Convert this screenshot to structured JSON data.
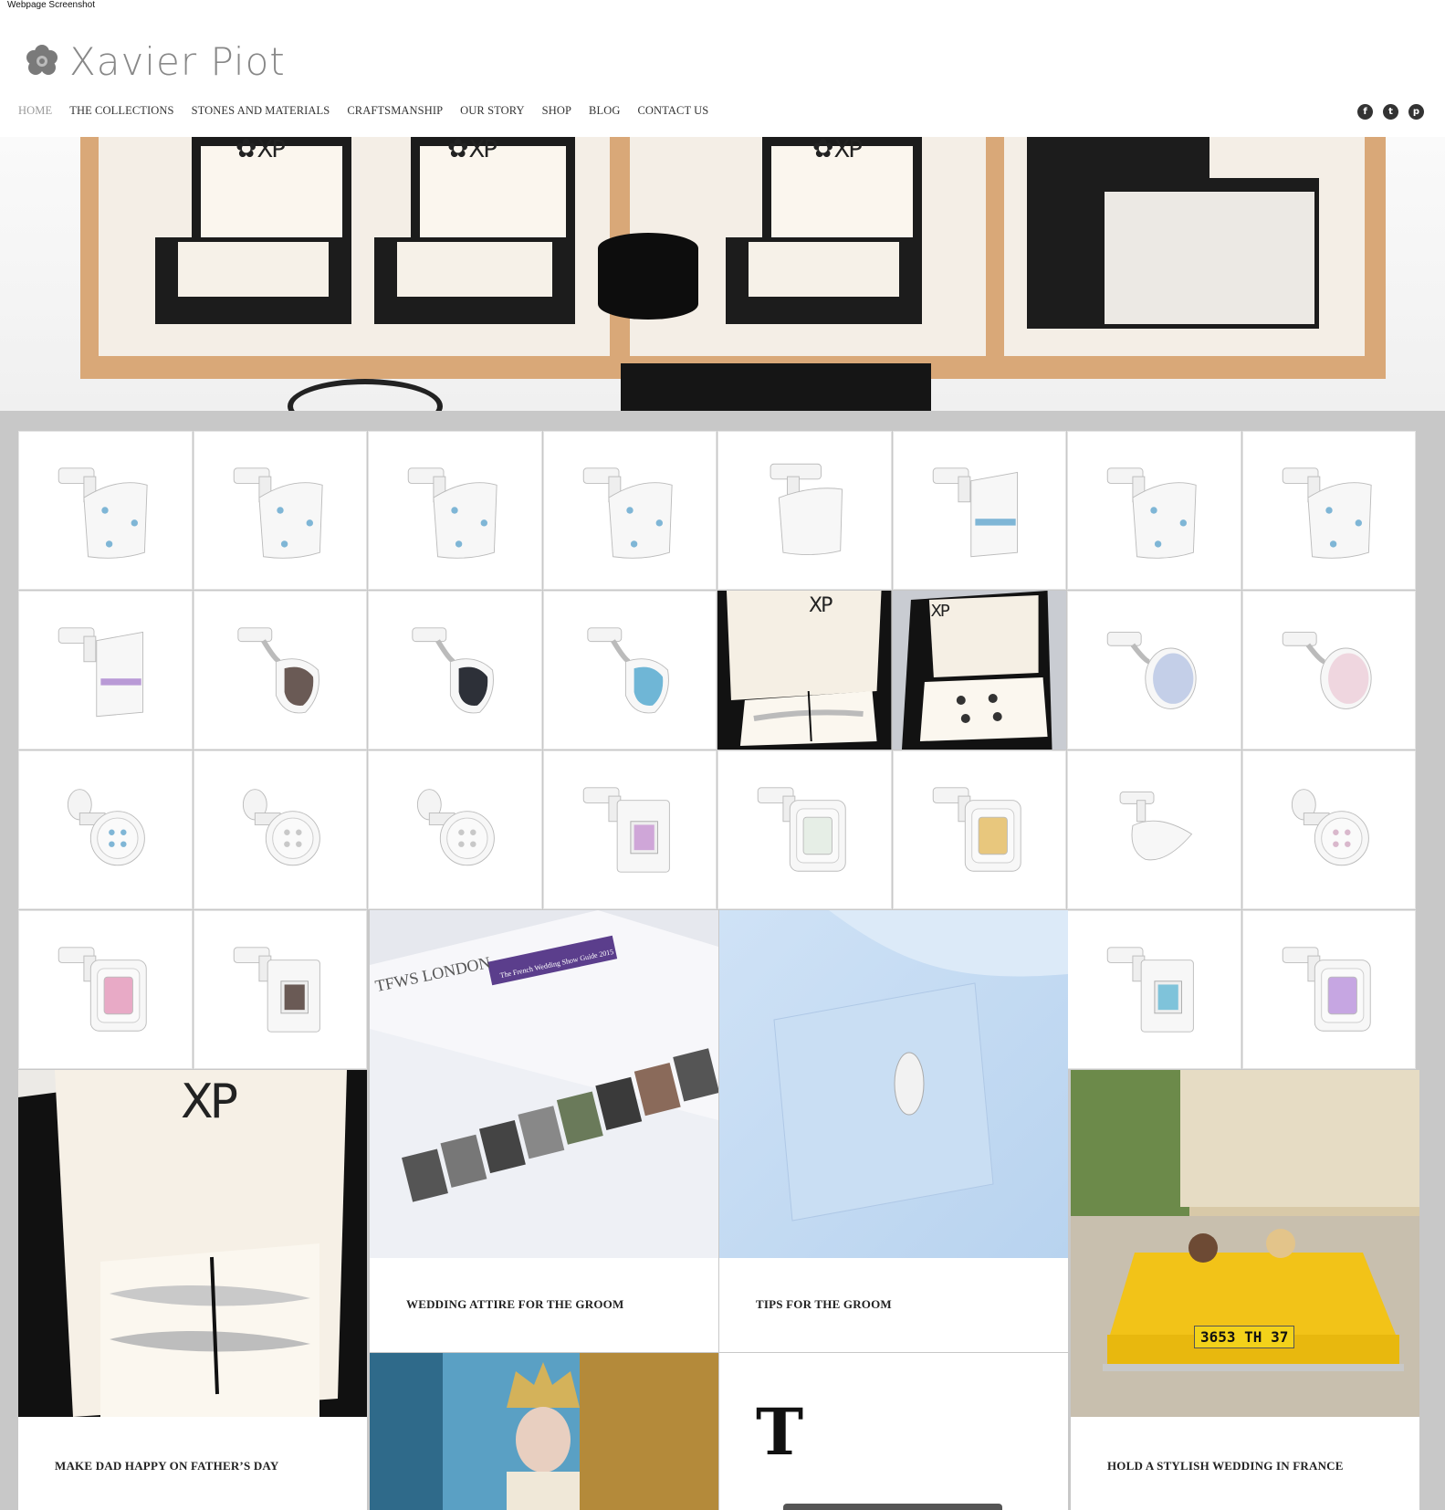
{
  "screenshot_label": "Webpage Screenshot",
  "brand": {
    "name": "Xavier Piot",
    "logo_icon": "camellia-flower-icon"
  },
  "nav": {
    "items": [
      {
        "label": "HOME",
        "active": true
      },
      {
        "label": "THE COLLECTIONS"
      },
      {
        "label": "STONES AND MATERIALS"
      },
      {
        "label": "CRAFTSMANSHIP"
      },
      {
        "label": "OUR STORY"
      },
      {
        "label": "SHOP"
      },
      {
        "label": "BLOG"
      },
      {
        "label": "CONTACT US"
      }
    ]
  },
  "social": [
    {
      "icon": "facebook-icon",
      "glyph": "f"
    },
    {
      "icon": "twitter-icon",
      "glyph": "t"
    },
    {
      "icon": "pinterest-icon",
      "glyph": "p"
    }
  ],
  "hero": {
    "box_logo": "XP"
  },
  "products": [
    {
      "style": "square",
      "stone": "#7fb6d6"
    },
    {
      "style": "square",
      "stone": "#7fb6d6"
    },
    {
      "style": "square",
      "stone": "#7fb6d6"
    },
    {
      "style": "square",
      "stone": "#7fb6d6"
    },
    {
      "style": "plain",
      "stone": ""
    },
    {
      "style": "bar",
      "stone": "#7fb6d6"
    },
    {
      "style": "square",
      "stone": "#7fb6d6"
    },
    {
      "style": "square",
      "stone": "#7fb6d6"
    },
    {
      "style": "bar",
      "stone": "#b99ad6"
    },
    {
      "style": "cushion",
      "stone": "#6a5a55"
    },
    {
      "style": "cushion",
      "stone": "#2d3038"
    },
    {
      "style": "cushion",
      "stone": "#6fb6d6"
    },
    {
      "style": "photo-box",
      "stone": ""
    },
    {
      "style": "photo-box-dark",
      "stone": ""
    },
    {
      "style": "oval",
      "stone": "#c4cfe8"
    },
    {
      "style": "oval",
      "stone": "#efd6df"
    },
    {
      "style": "button",
      "stone": "#7fb6d6"
    },
    {
      "style": "button",
      "stone": "#c8c8c8"
    },
    {
      "style": "button",
      "stone": "#c8c8c8"
    },
    {
      "style": "frame",
      "stone": "#cfa6d8"
    },
    {
      "style": "emerald",
      "stone": "#e6eee6"
    },
    {
      "style": "emerald",
      "stone": "#e8c77d"
    },
    {
      "style": "acorn",
      "stone": ""
    },
    {
      "style": "button",
      "stone": "#d9b8cc"
    },
    {
      "style": "emerald",
      "stone": "#e8aac6"
    },
    {
      "style": "frame",
      "stone": "#6a5a55"
    },
    {
      "style": "frame",
      "stone": "#7fc3da"
    },
    {
      "style": "emerald",
      "stone": "#c6a6e2"
    }
  ],
  "posts": [
    {
      "title": "WEDDING ATTIRE FOR THE GROOM",
      "image": "brochure"
    },
    {
      "title": "TIPS FOR THE GROOM",
      "image": "shirt-cuff"
    },
    {
      "title": "MAKE DAD HAPPY ON FATHER’S DAY",
      "image": "collar-stays-box"
    },
    {
      "title": "HOLD A STYLISH WEDDING IN FRANCE",
      "image": "yellow-car",
      "plate": "3653 TH 37"
    },
    {
      "title": "",
      "image": "queen-portrait"
    },
    {
      "title": "",
      "image": "times-logo",
      "logo_text": "T"
    }
  ],
  "brochure": {
    "org": "TFWS LONDON",
    "banner": "The French Wedding Show Guide 2015"
  },
  "colors": {
    "nav_active": "#999999",
    "grid_bg": "#c8c8c8",
    "logo_gray": "#888888"
  }
}
